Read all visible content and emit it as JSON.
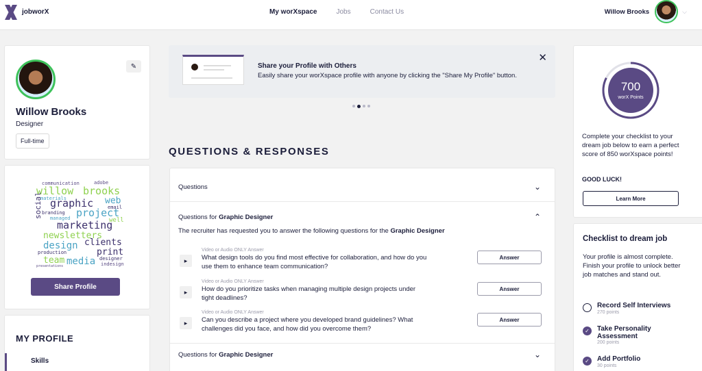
{
  "brand": {
    "name": "jobworX",
    "accent": "#5a4a84",
    "success": "#3ec25a"
  },
  "nav": {
    "items": [
      "My worXspace",
      "Jobs",
      "Contact Us"
    ],
    "active_index": 0
  },
  "user": {
    "name": "Willow Brooks"
  },
  "profile": {
    "name": "Willow Brooks",
    "role": "Designer",
    "tag": "Full-time"
  },
  "word_cloud": {
    "words": [
      "communication",
      "adobe",
      "willow",
      "brooks",
      "graphic",
      "materials",
      "web",
      "email",
      "branding",
      "project",
      "social",
      "managed",
      "marketing",
      "well",
      "newsletters",
      "clients",
      "design",
      "production",
      "print",
      "team",
      "media",
      "designer",
      "indesign",
      "presentations"
    ]
  },
  "share_button": "Share Profile",
  "my_profile": {
    "title": "MY PROFILE",
    "items": [
      "Skills"
    ]
  },
  "banner": {
    "title": "Share your Profile with Others",
    "text": "Easily share your worXspace profile with anyone by clicking the \"Share My Profile\" button.",
    "slides": 4,
    "active_slide": 1
  },
  "qr": {
    "title": "QUESTIONS & RESPONSES",
    "sections": [
      {
        "prefix": "Questions",
        "bold": ""
      },
      {
        "prefix": "Questions for ",
        "bold": "Graphic Designer"
      },
      {
        "prefix": "Questions for ",
        "bold": "Graphic Designer"
      }
    ],
    "request_prefix": "The recruiter has requested you to answer the following questions for the ",
    "request_bold": "Graphic Designer",
    "questions": [
      {
        "type": "Video or Audio ONLY Answer",
        "text": "What design tools do you find most effective for collaboration, and how do you use them to enhance team communication?",
        "button": "Answer"
      },
      {
        "type": "Video or Audio ONLY Answer",
        "text": "How do you prioritize tasks when managing multiple design projects under tight deadlines?",
        "button": "Answer"
      },
      {
        "type": "Video or Audio ONLY Answer",
        "text": "Can you describe a project where you developed brand guidelines? What challenges did you face, and how did you overcome them?",
        "button": "Answer"
      }
    ]
  },
  "score": {
    "value": "700",
    "label": "worX Points",
    "fraction_of_max": 0.824,
    "text": "Complete your checklist to your dream job below to earn a perfect score of 850 worXspace points!",
    "good_luck": "GOOD LUCK!",
    "button": "Learn More"
  },
  "checklist": {
    "title": "Checklist to dream job",
    "text": "Your profile is almost complete. Finish your profile to unlock better job matches and stand out.",
    "items": [
      {
        "label": "Record Self Interviews",
        "points": "270 points",
        "done": false
      },
      {
        "label": "Take Personality Assessment",
        "points": "200 points",
        "done": true
      },
      {
        "label": "Add Portfolio",
        "points": "30 points",
        "done": true
      }
    ]
  }
}
